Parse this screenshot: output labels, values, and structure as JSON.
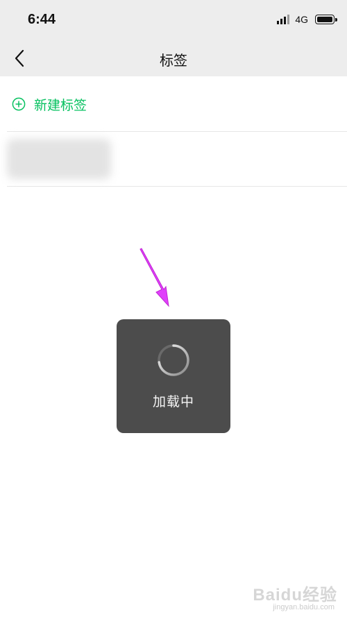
{
  "status_bar": {
    "time": "6:44",
    "network": "4G",
    "signal_bars": 4,
    "battery_level": 0.9,
    "icons": [
      "signal-icon",
      "battery-icon"
    ]
  },
  "nav": {
    "title": "标签",
    "back_icon": "chevron-left-icon"
  },
  "new_tag": {
    "label": "新建标签",
    "icon": "plus-circle-icon",
    "color": "#07c160"
  },
  "tag_list": [
    {
      "label_visible": false
    }
  ],
  "annotation": {
    "arrow_color": "#e040fb",
    "icon": "arrow-annotation-icon"
  },
  "loading_toast": {
    "label": "加载中",
    "icon": "spinner-icon",
    "background": "#4c4c4c"
  },
  "watermark": {
    "logo": "Baidu经验",
    "url": "jingyan.baidu.com"
  }
}
